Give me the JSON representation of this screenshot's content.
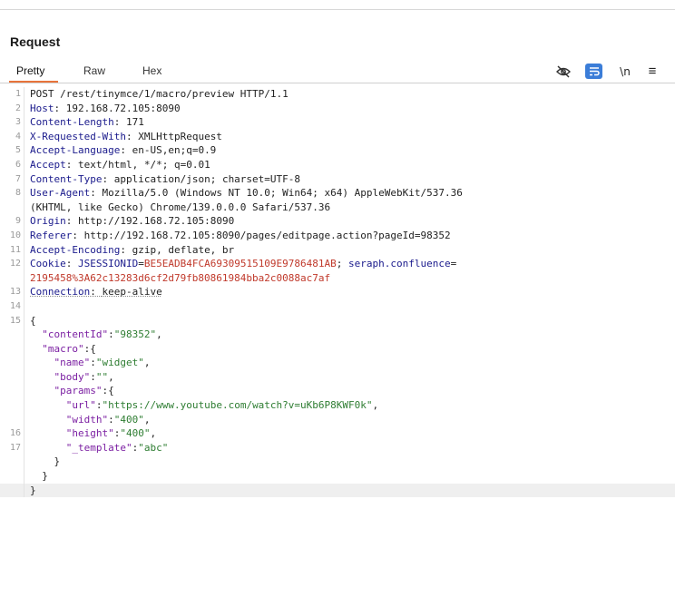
{
  "panel": {
    "title": "Request"
  },
  "tabs": [
    "Pretty",
    "Raw",
    "Hex"
  ],
  "toolbar": {
    "hide_icon": "eye-slash-icon",
    "wrap_icon": "wrap-lines-icon",
    "newline_label": "\\n",
    "menu_icon": "≡"
  },
  "request": {
    "line_numbers": [
      "1",
      "2",
      "3",
      "4",
      "5",
      "6",
      "7",
      "8",
      "",
      "9",
      "10",
      "11",
      "12",
      "",
      "13",
      "14",
      "15",
      "",
      "",
      "",
      "",
      "",
      "",
      "",
      "16",
      "17",
      "",
      "",
      ""
    ],
    "request_line": "POST /rest/tinymce/1/macro/preview HTTP/1.1",
    "headers": [
      {
        "name": "Host",
        "value": "192.168.72.105:8090"
      },
      {
        "name": "Content-Length",
        "value": "171"
      },
      {
        "name": "X-Requested-With",
        "value": "XMLHttpRequest"
      },
      {
        "name": "Accept-Language",
        "value": "en-US,en;q=0.9"
      },
      {
        "name": "Accept",
        "value": "text/html, */*; q=0.01"
      },
      {
        "name": "Content-Type",
        "value": "application/json; charset=UTF-8"
      },
      {
        "name": "User-Agent",
        "value": "Mozilla/5.0 (Windows NT 10.0; Win64; x64) AppleWebKit/537.36",
        "cont": "(KHTML, like Gecko) Chrome/139.0.0.0 Safari/537.36"
      },
      {
        "name": "Origin",
        "value": "http://192.168.72.105:8090"
      },
      {
        "name": "Referer",
        "value": "http://192.168.72.105:8090/pages/editpage.action?pageId=98352"
      },
      {
        "name": "Accept-Encoding",
        "value": "gzip, deflate, br"
      }
    ],
    "cookie": {
      "name": "Cookie",
      "c1_name": "JSESSIONID",
      "c1_value": "BE5EADB4FCA69309515109E9786481AB",
      "c2_name": "seraph.confluence",
      "c2_value": "2195458%3A62c13283d6cf2d79fb80861984bba2c0088ac7af"
    },
    "connection": {
      "name": "Connection",
      "value": "keep-alive"
    },
    "body": {
      "contentId": "98352",
      "name": "widget",
      "body": "",
      "url": "https://www.youtube.com/watch?v=uKb6P8KWF0k",
      "width": "400",
      "height": "400",
      "template": "abc"
    }
  }
}
